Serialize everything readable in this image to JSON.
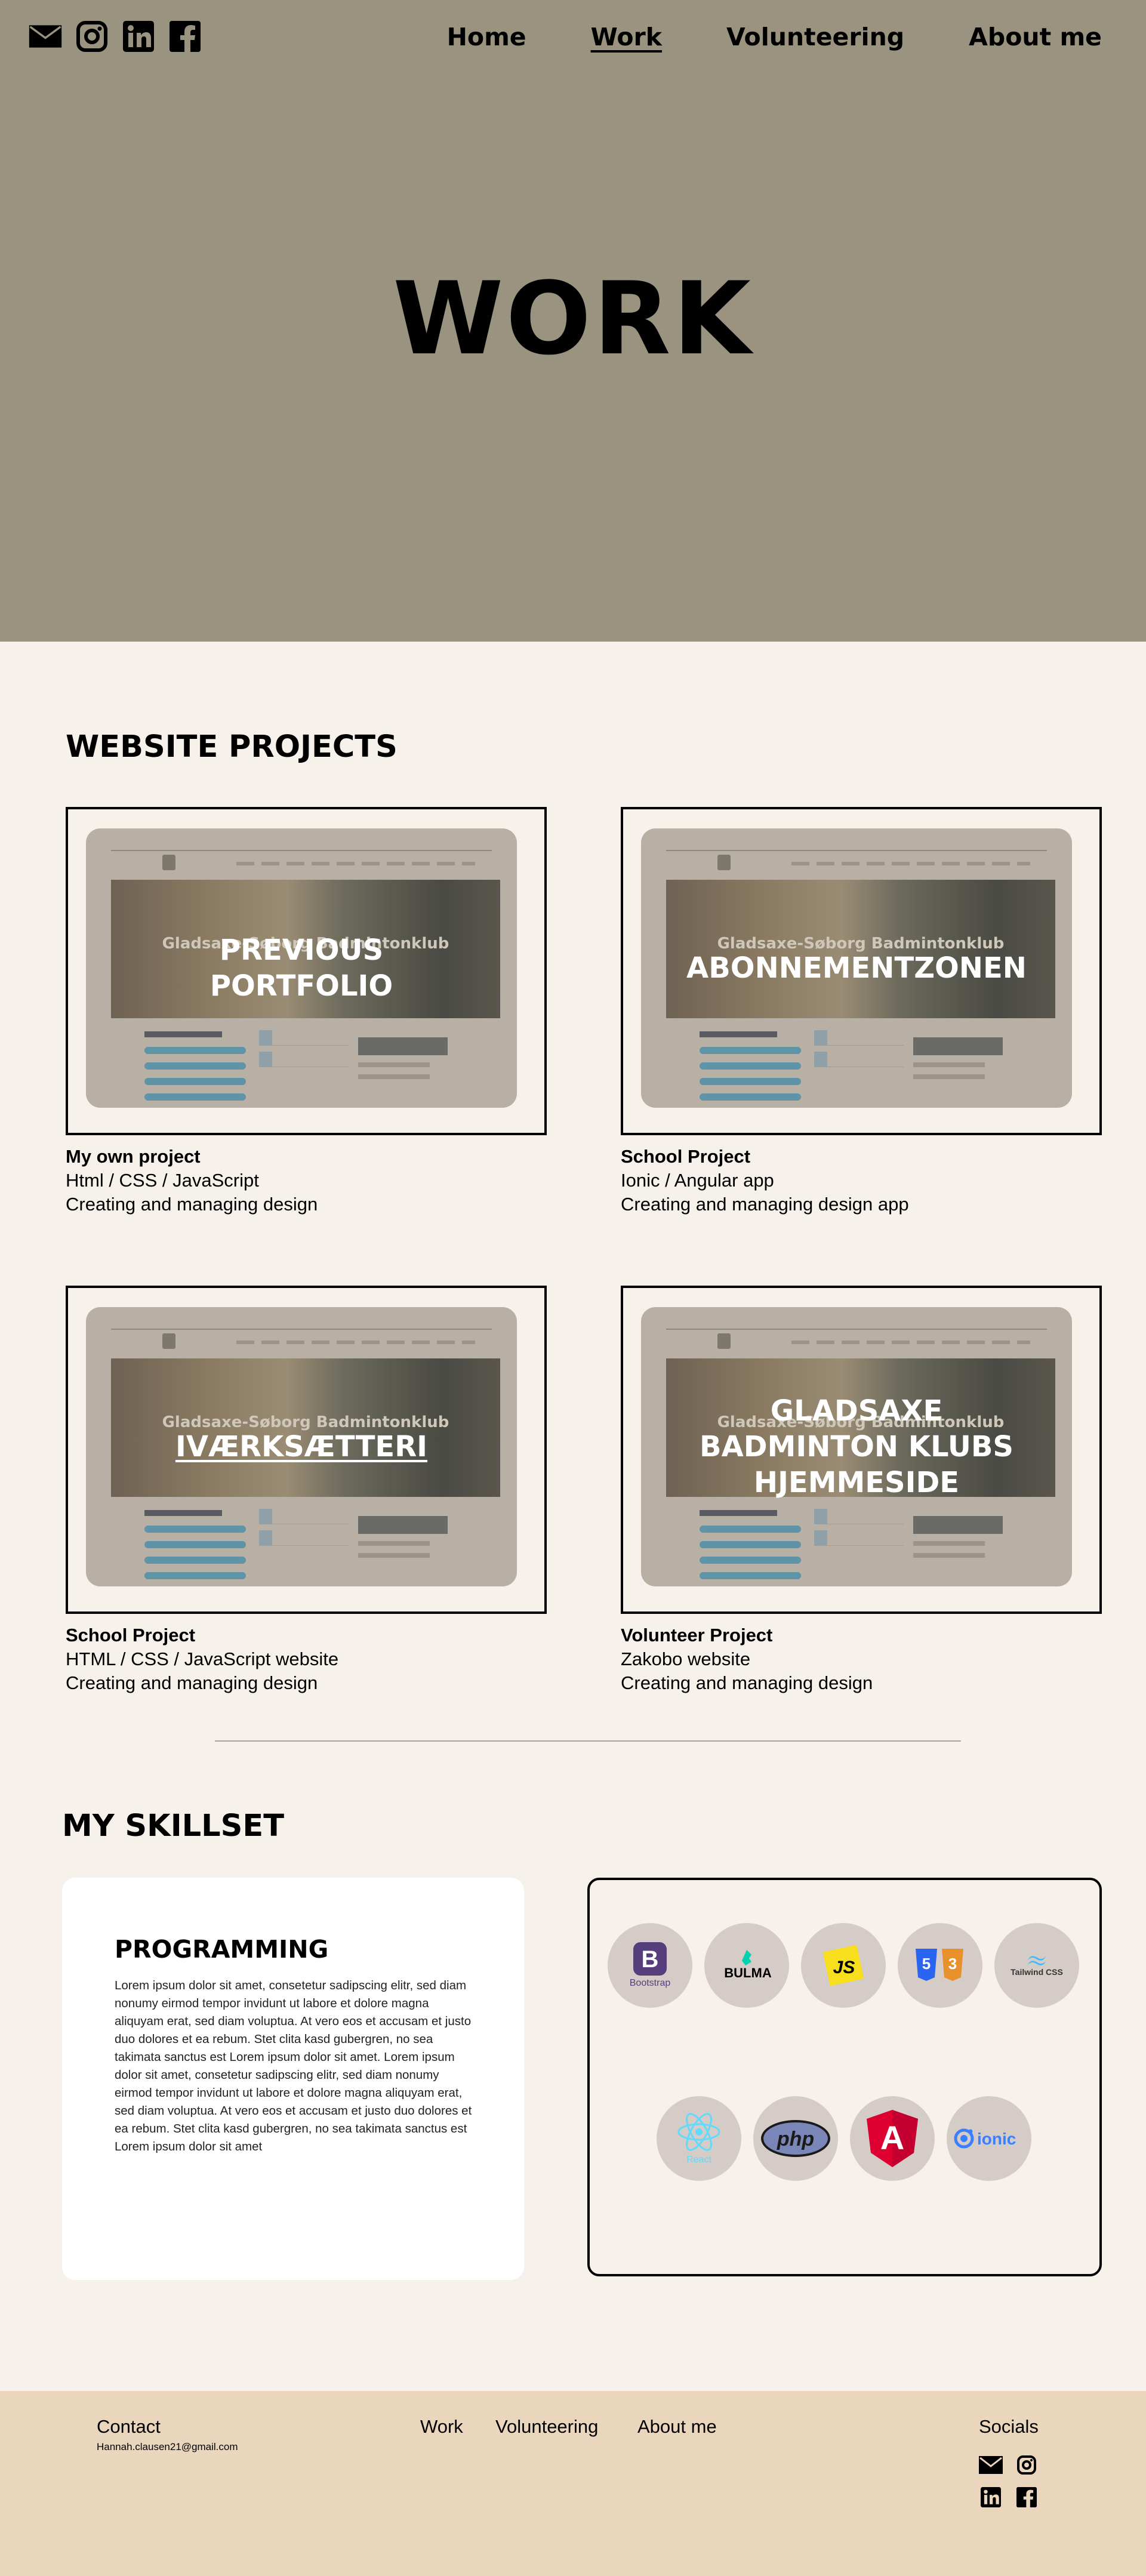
{
  "nav": {
    "socials": [
      "mail-icon",
      "instagram-icon",
      "linkedin-icon",
      "facebook-icon"
    ],
    "links": [
      {
        "label": "Home",
        "active": false
      },
      {
        "label": "Work",
        "active": true
      },
      {
        "label": "Volunteering",
        "active": false
      },
      {
        "label": "About me",
        "active": false
      }
    ]
  },
  "hero": {
    "title": "WORK"
  },
  "projects": {
    "heading": "WEBSITE PROJECTS",
    "thumb_subtitle": "Gladsaxe-Søborg Badmintonklub",
    "items": [
      {
        "overlay": "PREVIOUS\nPORTFOLIO",
        "type": "My own project",
        "tech": "Html / CSS / JavaScript",
        "desc": "Creating and managing design"
      },
      {
        "overlay": "ABONNEMENTZONEN",
        "type": "School Project",
        "tech": "Ionic / Angular app",
        "desc": "Creating and managing design app"
      },
      {
        "overlay": "IVÆRKSÆTTERI",
        "type": "School Project",
        "tech": "HTML / CSS / JavaScript website",
        "desc": "Creating and managing design"
      },
      {
        "overlay": "GLADSAXE\nBADMINTON KLUBS\nHJEMMESIDE",
        "type": "Volunteer Project",
        "tech": "Zakobo website",
        "desc": "Creating and managing design"
      }
    ]
  },
  "skills": {
    "heading": "MY SKILLSET",
    "card_title": "PROGRAMMING",
    "card_text": "Lorem ipsum dolor sit amet, consetetur sadipscing elitr, sed diam nonumy eirmod tempor invidunt ut labore et dolore magna aliquyam erat, sed diam voluptua. At vero eos et accusam et justo duo dolores et ea rebum. Stet clita kasd gubergren, no sea takimata sanctus est Lorem ipsum dolor sit amet. Lorem ipsum dolor sit amet, consetetur sadipscing elitr, sed diam nonumy eirmod tempor invidunt ut labore et dolore magna aliquyam erat, sed diam voluptua. At vero eos et accusam et justo duo dolores et ea rebum. Stet clita kasd gubergren, no sea takimata sanctus est Lorem ipsum dolor sit amet",
    "tech": [
      {
        "name": "bootstrap-icon",
        "caption": "Bootstrap"
      },
      {
        "name": "bulma-icon",
        "caption": "BULMA"
      },
      {
        "name": "javascript-icon",
        "caption": "JS"
      },
      {
        "name": "html-css-icon",
        "caption": ""
      },
      {
        "name": "tailwind-icon",
        "caption": "Tailwind CSS"
      },
      {
        "name": "react-icon",
        "caption": "React"
      },
      {
        "name": "php-icon",
        "caption": "php"
      },
      {
        "name": "angular-icon",
        "caption": "A"
      },
      {
        "name": "ionic-icon",
        "caption": "ionic"
      }
    ]
  },
  "footer": {
    "contact": "Contact",
    "email": "Hannah.clausen21@gmail.com",
    "links": [
      "Work",
      "Volunteering",
      "About me"
    ],
    "socials_label": "Socials"
  },
  "colors": {
    "hero_bg": "#99937f",
    "page_bg": "#f6f1ea",
    "footer_bg": "#e9d6bd",
    "tech_circle": "#d5ccc8"
  }
}
